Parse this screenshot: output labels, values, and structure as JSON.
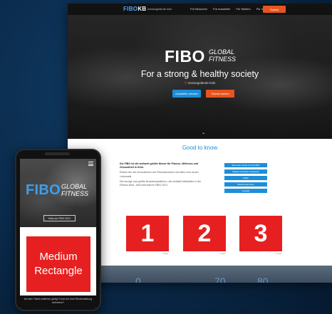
{
  "desktop": {
    "nav": {
      "logo_main": "FIBO",
      "logo_accent": "KB",
      "tagline": "messegelände köln",
      "links": [
        "Für Besucher",
        "Für Aussteller",
        "Für Medien",
        "Für mehr"
      ],
      "cta": "Tickets"
    },
    "hero": {
      "logo_main": "FIBO",
      "logo_line1": "GLOBAL",
      "logo_line2": "FITNESS",
      "headline": "For a strong & healthy society",
      "location_pin": "⚲",
      "location": "messegelände köln",
      "button_blue": "Aussteller werden",
      "button_orange": "Tickets kaufen",
      "chevron": "⌄"
    },
    "good_to_know": {
      "title": "Good to know",
      "intro": [
        "Die FIBO ist die weltweit größte Messe für Fitness, Wellness und Gesundheit in Köln.",
        "Erlebe hier die Innovationen der Fitnessbranche und alles zum neuen Lebensstil.",
        "Die einzige und größte Branchenplattform, die weltweit Maßstäbe in der Fitness setzt. Jetzt informieren FIBO 2021."
      ],
      "side_buttons": [
        "Besucher-Guide für die FIBO",
        "Digitale Aussteller-Angebote",
        "FAQs",
        "Branchentermine",
        "Kontakt"
      ]
    },
    "numbers": [
      "1",
      "2",
      "3"
    ],
    "number_caption": "Image",
    "stats": [
      "0",
      "70",
      "80"
    ]
  },
  "phone": {
    "logo_main": "FIBO",
    "logo_line1": "GLOBAL",
    "logo_line2": "FITNESS",
    "hero_button": "Infos zur FIBO 2021",
    "ad_line1": "Medium",
    "ad_line2": "Rectangle",
    "bottom_text": "Ist mein Ticket weiterhin gültig? Kann ich eine Rückerstattung anfordern?"
  },
  "colors": {
    "background": "#0a2a4a",
    "brand_blue": "#1e8ed8",
    "brand_orange": "#e8541e",
    "ad_red": "#e62020"
  }
}
